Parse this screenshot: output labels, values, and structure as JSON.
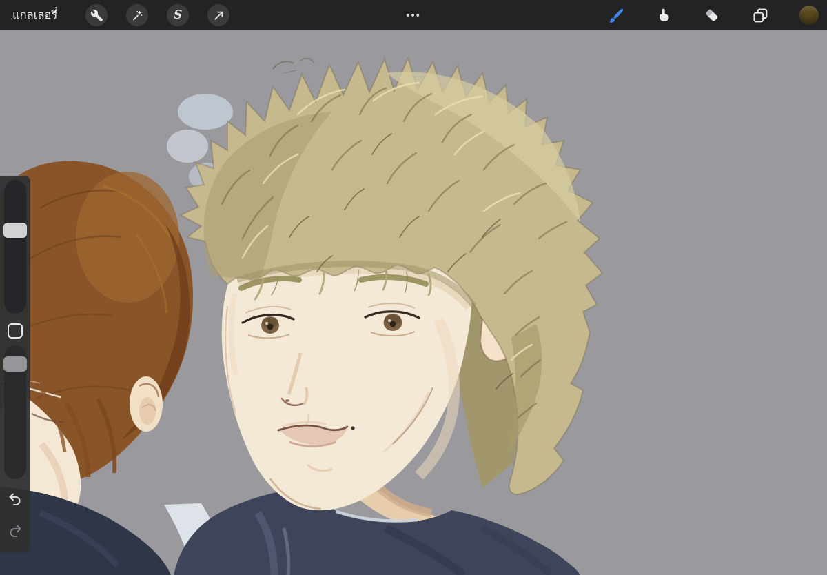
{
  "topbar": {
    "gallery_label": "แกลเลอรี่",
    "overflow_label": "•••",
    "tools_left": [
      {
        "name": "actions",
        "icon": "wrench-icon"
      },
      {
        "name": "adjustments",
        "icon": "magic-wand-icon"
      },
      {
        "name": "selection",
        "icon": "selection-s-icon",
        "glyph": "S"
      },
      {
        "name": "transform",
        "icon": "transform-arrow-icon"
      }
    ],
    "tools_right": [
      {
        "name": "paint",
        "icon": "brush-icon",
        "active": true
      },
      {
        "name": "smudge",
        "icon": "smudge-icon",
        "active": false
      },
      {
        "name": "erase",
        "icon": "eraser-icon",
        "active": false
      },
      {
        "name": "layers",
        "icon": "layers-icon",
        "active": false
      },
      {
        "name": "color",
        "icon": "color-swatch",
        "active": false
      }
    ],
    "accent_blue": "#3f82e8",
    "color_swatch_hex": "#5c4a1e"
  },
  "sidebar": {
    "brush_size_fraction": 0.33,
    "opacity_fraction": 0.09
  },
  "canvas": {
    "background_hex": "#9a9a9e",
    "artwork_description": "Digital portrait painting: foreground figure with messy ash-blond spiky hair, brown eyes and navy shirt; second figure with brown bowl-cut hair partially visible at left edge",
    "palette": {
      "blond_hair": "#c6b98e",
      "blond_shadow": "#a2966c",
      "brown_hair": "#8a5429",
      "skin": "#f4e7d4",
      "shirt_navy": "#3e4459",
      "shirt_navy_dark": "#2f3647"
    }
  }
}
